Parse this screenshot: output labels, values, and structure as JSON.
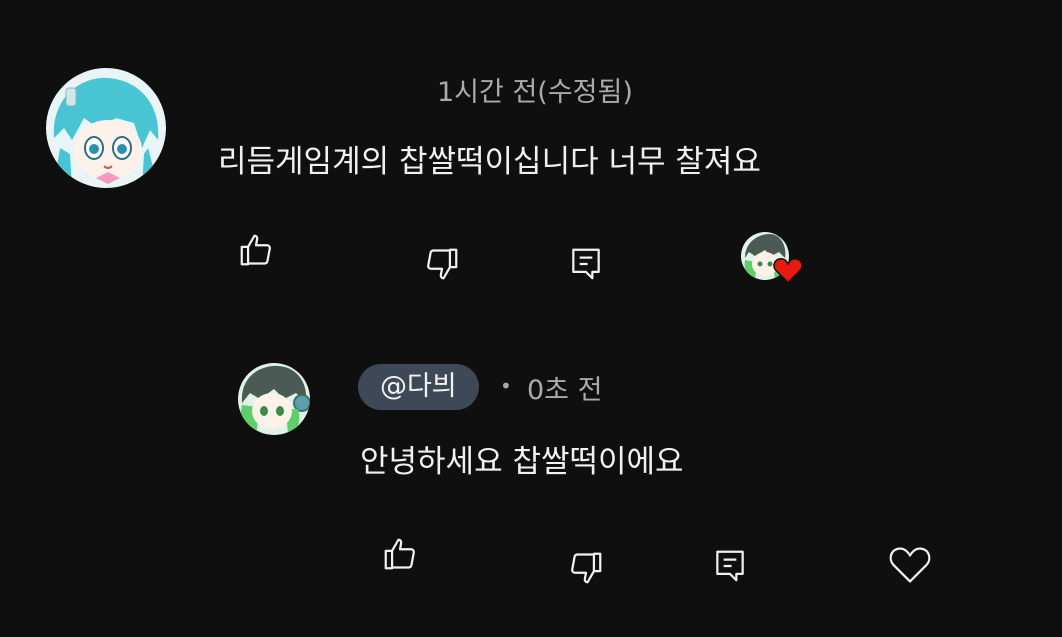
{
  "colors": {
    "background": "#0f0f0f",
    "primary_text": "#f1f1f1",
    "secondary_text": "#aaaaaa",
    "handle_chip": "#3f4856",
    "heart_badge": "#e8190f"
  },
  "comment": {
    "timestamp": "1시간 전(수정됨)",
    "text": "리듬게임계의 찹쌀떡이십니다 너무 찰져요",
    "actions": {
      "like_icon": "thumbs-up-icon",
      "dislike_icon": "thumbs-down-icon",
      "reply_icon": "reply-icon",
      "creator_heart_icon": "creator-heart-icon"
    }
  },
  "reply": {
    "handle": "@다븨",
    "separator": "•",
    "timestamp": "0초 전",
    "text": "안녕하세요 찹쌀떡이에요",
    "actions": {
      "like_icon": "thumbs-up-icon",
      "dislike_icon": "thumbs-down-icon",
      "reply_icon": "reply-icon",
      "heart_icon": "heart-outline-icon"
    }
  }
}
